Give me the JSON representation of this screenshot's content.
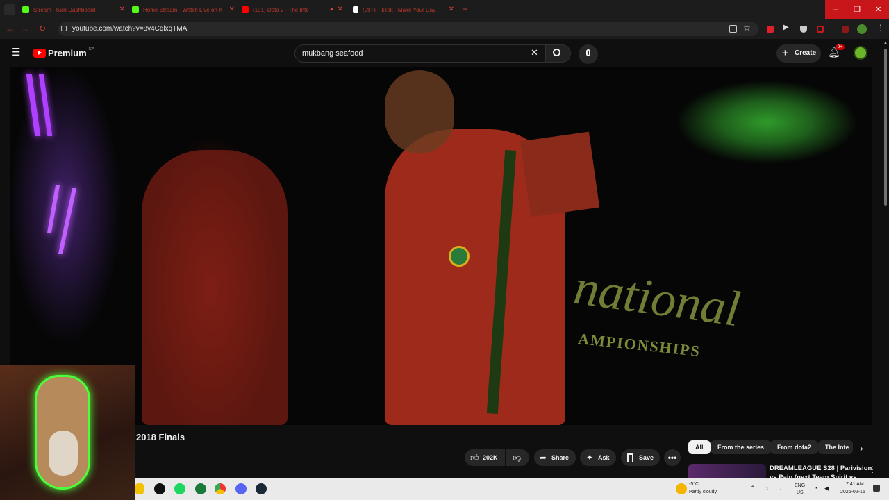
{
  "browser": {
    "tabs": [
      {
        "label": "Stream - Kick Dashboard",
        "favicon_color": "#53fc18"
      },
      {
        "label": "Home Stream - Watch Live on K",
        "favicon_color": "#53fc18"
      },
      {
        "label": "(191) Dota 2 - The Inte",
        "favicon_color": "#ff0000"
      },
      {
        "label": "(99+) TikTok - Make Your Day",
        "favicon_color": "#ffffff"
      }
    ],
    "new_tab_label": "+",
    "window_controls": {
      "minimize": "–",
      "maximize": "❐",
      "close": "✕"
    },
    "url": "youtube.com/watch?v=8v4CqlxqTMA"
  },
  "youtube": {
    "brand": "Premium",
    "region": "CA",
    "search_query": "mukbang seafood",
    "create_label": "Create",
    "notification_badge": "9+",
    "accent": "#ff0000"
  },
  "video": {
    "title_fragment": "2018 Finals",
    "overlay_text_1": "national",
    "overlay_text_2": "AMPIONSHIPS"
  },
  "actions": {
    "likes": "202K",
    "share": "Share",
    "ask": "Ask",
    "save": "Save"
  },
  "chips": [
    "All",
    "From the series",
    "From dota2",
    "The Inte"
  ],
  "recommendation": {
    "title_line1": "DREAMLEAGUE S28 | Parivision",
    "title_line2": "vs Pain (next Team Spirit vs"
  },
  "taskbar": {
    "weather_temp": "-5°C",
    "weather_desc": "Partly cloudy",
    "lang_1": "ENG",
    "lang_2": "US",
    "time": "7:41 AM",
    "date": "2026-02-16"
  }
}
